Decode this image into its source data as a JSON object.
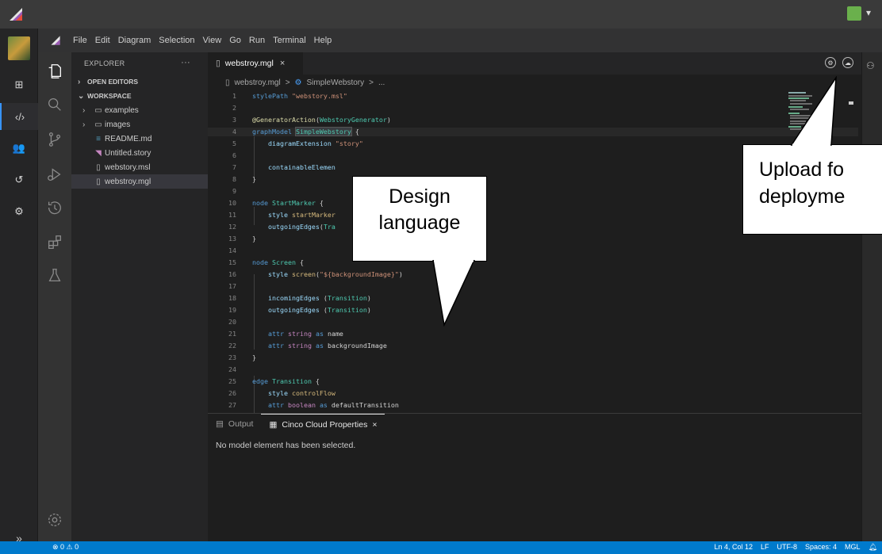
{
  "menubar": {
    "items": [
      "File",
      "Edit",
      "Diagram",
      "Selection",
      "View",
      "Go",
      "Run",
      "Terminal",
      "Help"
    ]
  },
  "explorer": {
    "title": "EXPLORER",
    "more": "···",
    "open_editors": "OPEN EDITORS",
    "workspace": "WORKSPACE",
    "items": [
      {
        "label": "examples",
        "kind": "folder"
      },
      {
        "label": "images",
        "kind": "folder"
      },
      {
        "label": "README.md",
        "kind": "markdown"
      },
      {
        "label": "Untitled.story",
        "kind": "story"
      },
      {
        "label": "webstory.msl",
        "kind": "file"
      },
      {
        "label": "webstroy.mgl",
        "kind": "file",
        "selected": true
      }
    ]
  },
  "tab": {
    "label": "webstroy.mgl",
    "close": "×"
  },
  "breadcrumb": {
    "file": "webstroy.mgl",
    "sep": ">",
    "symbol": "SimpleWebstory",
    "more": "..."
  },
  "editor_lines": [
    {
      "n": "1",
      "t": "stylePath \"webstory.msl\""
    },
    {
      "n": "2",
      "t": ""
    },
    {
      "n": "3",
      "t": "@GeneratorAction(WebstoryGenerator)"
    },
    {
      "n": "4",
      "t": "graphModel SimpleWebstory {"
    },
    {
      "n": "5",
      "t": "    diagramExtension \"story\""
    },
    {
      "n": "6",
      "t": ""
    },
    {
      "n": "7",
      "t": "    containableElemen"
    },
    {
      "n": "8",
      "t": "}"
    },
    {
      "n": "9",
      "t": ""
    },
    {
      "n": "10",
      "t": "node StartMarker {"
    },
    {
      "n": "11",
      "t": "    style startMarker"
    },
    {
      "n": "12",
      "t": "    outgoingEdges(Tra"
    },
    {
      "n": "13",
      "t": "}"
    },
    {
      "n": "14",
      "t": ""
    },
    {
      "n": "15",
      "t": "node Screen {"
    },
    {
      "n": "16",
      "t": "    style screen(\"${backgroundImage}\")"
    },
    {
      "n": "17",
      "t": ""
    },
    {
      "n": "18",
      "t": "    incomingEdges (Transition)"
    },
    {
      "n": "19",
      "t": "    outgoingEdges (Transition)"
    },
    {
      "n": "20",
      "t": ""
    },
    {
      "n": "21",
      "t": "    attr string as name"
    },
    {
      "n": "22",
      "t": "    attr string as backgroundImage"
    },
    {
      "n": "23",
      "t": "}"
    },
    {
      "n": "24",
      "t": ""
    },
    {
      "n": "25",
      "t": "edge Transition {"
    },
    {
      "n": "26",
      "t": "    style controlFlow"
    },
    {
      "n": "27",
      "t": "    attr boolean as defaultTransition"
    }
  ],
  "panel": {
    "tabs": [
      "Output",
      "Cinco Cloud Properties"
    ],
    "close": "×",
    "message": "No model element has been selected."
  },
  "status": {
    "left": "⊗ 0 ⚠ 0",
    "right": [
      "Ln 4, Col 12",
      "LF",
      "UTF-8",
      "Spaces: 4",
      "MGL"
    ]
  },
  "callouts": {
    "design": [
      "Design",
      "language"
    ],
    "upload": [
      "Upload fo",
      "deployme"
    ]
  },
  "colors": {
    "accent": "#007acc",
    "keyword": "#569cd6",
    "type": "#4ec9b0",
    "string": "#ce9178"
  }
}
